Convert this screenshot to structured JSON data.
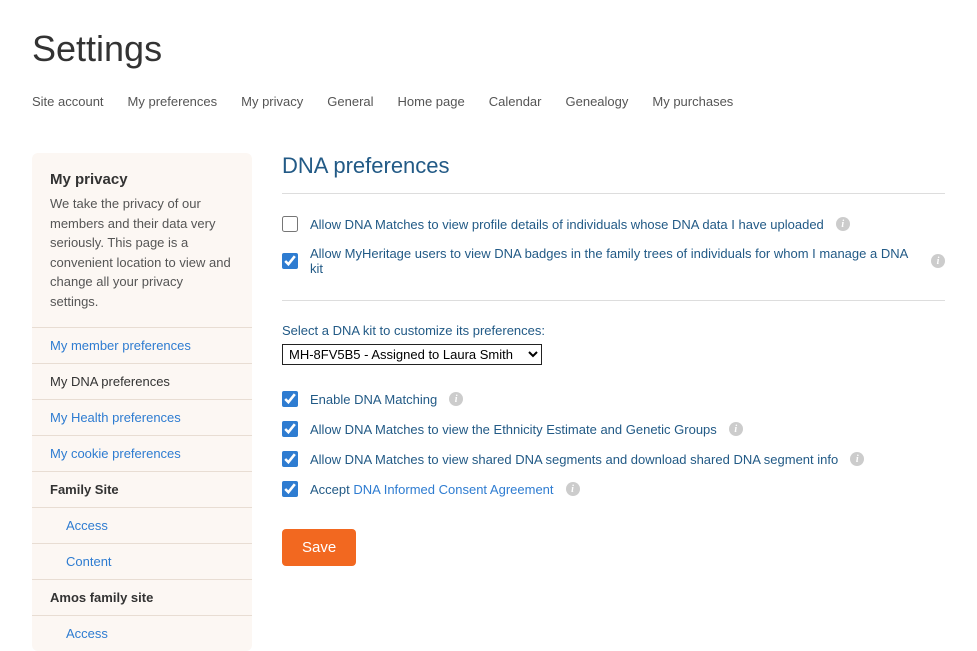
{
  "page_title": "Settings",
  "tabs": [
    "Site account",
    "My preferences",
    "My privacy",
    "General",
    "Home page",
    "Calendar",
    "Genealogy",
    "My purchases"
  ],
  "sidebar": {
    "heading": "My privacy",
    "description": "We take the privacy of our members and their data very seriously. This page is a convenient location to view and change all your privacy settings.",
    "items": [
      {
        "label": "My member preferences",
        "type": "link"
      },
      {
        "label": "My DNA preferences",
        "type": "active"
      },
      {
        "label": "My Health preferences",
        "type": "link"
      },
      {
        "label": "My cookie preferences",
        "type": "link"
      },
      {
        "label": "Family Site",
        "type": "section"
      },
      {
        "label": "Access",
        "type": "sub"
      },
      {
        "label": "Content",
        "type": "sub"
      },
      {
        "label": "Amos family site",
        "type": "section"
      },
      {
        "label": "Access",
        "type": "sub"
      }
    ]
  },
  "main": {
    "title": "DNA preferences",
    "global": [
      {
        "label": "Allow DNA Matches to view profile details of individuals whose DNA data I have uploaded",
        "checked": false,
        "info": true
      },
      {
        "label": "Allow MyHeritage users to view DNA badges in the family trees of individuals for whom I manage a DNA kit",
        "checked": true,
        "info": true
      }
    ],
    "kit_select_label": "Select a DNA kit to customize its preferences:",
    "kit_selected": "MH-8FV5B5 - Assigned to Laura Smith",
    "kit_options": [
      "MH-8FV5B5 - Assigned to Laura Smith"
    ],
    "kit_prefs": [
      {
        "label": "Enable DNA Matching",
        "checked": true,
        "info": true
      },
      {
        "label": "Allow DNA Matches to view the Ethnicity Estimate and Genetic Groups",
        "checked": true,
        "info": true
      },
      {
        "label": "Allow DNA Matches to view shared DNA segments and download shared DNA segment info",
        "checked": true,
        "info": true
      },
      {
        "label_pre": "Accept ",
        "link_text": "DNA Informed Consent Agreement",
        "checked": true,
        "info": true,
        "has_link": true
      }
    ],
    "save_label": "Save"
  }
}
